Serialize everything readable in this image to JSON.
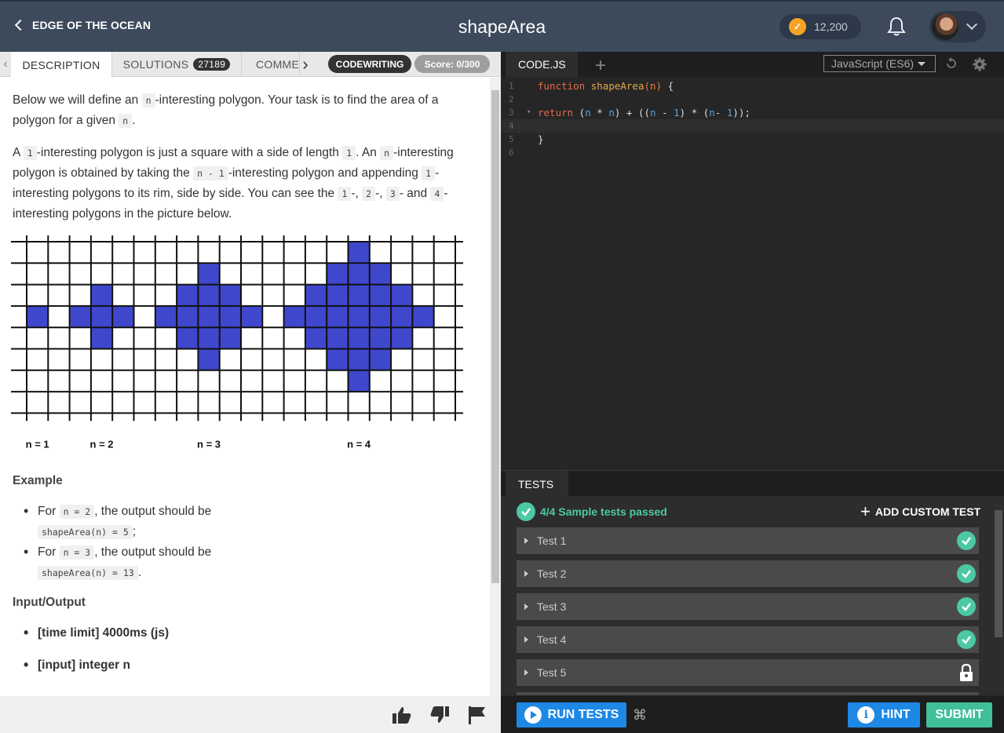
{
  "header": {
    "back_label": "EDGE OF THE OCEAN",
    "title": "shapeArea",
    "coins": "12,200"
  },
  "tabs": [
    {
      "label": "DESCRIPTION"
    },
    {
      "label": "SOLUTIONS",
      "count": "27189"
    },
    {
      "label": "COMMEN"
    }
  ],
  "pills": {
    "mode": "CODEWRITING",
    "score": "Score: 0/300"
  },
  "description": {
    "p1_a": "Below we will define an ",
    "p1_code": "n",
    "p1_b": "-interesting polygon. Your task is to find the area of a polygon for a given ",
    "p1_code2": "n",
    "p1_c": ".",
    "p2_a": "A ",
    "p2_code1": "1",
    "p2_b": "-interesting polygon is just a square with a side of length ",
    "p2_code2": "1",
    "p2_c": ". An ",
    "p2_code3": "n",
    "p2_d": "-interesting polygon is obtained by taking the ",
    "p2_code4": "n - 1",
    "p2_e": "-interesting polygon and appending ",
    "p2_code5": "1",
    "p2_f": "-interesting polygons to its rim, side by side. You can see the ",
    "p2_code6": "1",
    "p2_g": "-, ",
    "p2_code7": "2",
    "p2_h": "-, ",
    "p2_code8": "3",
    "p2_i": "- and ",
    "p2_code9": "4",
    "p2_j": "-interesting polygons in the picture below.",
    "figure_labels": [
      "n = 1",
      "n = 2",
      "n = 3",
      "n = 4"
    ],
    "example_heading": "Example",
    "examples": [
      {
        "pre": "For ",
        "input": "n = 2",
        "mid": ", the output should be",
        "output": "shapeArea(n) = 5",
        "end": ";"
      },
      {
        "pre": "For ",
        "input": "n = 3",
        "mid": ", the output should be",
        "output": "shapeArea(n) = 13",
        "end": "."
      }
    ],
    "io_heading": "Input/Output",
    "io_items": [
      "[time limit] 4000ms (js)",
      "[input] integer n"
    ]
  },
  "editor": {
    "tab": "CODE.JS",
    "language": "JavaScript (ES6)",
    "line_numbers": [
      "1",
      "2",
      "3",
      "4",
      "5",
      "6"
    ]
  },
  "tests": {
    "tab": "TESTS",
    "summary": "4/4 Sample tests passed",
    "add_custom": "ADD CUSTOM TEST",
    "rows": [
      {
        "label": "Test 1",
        "status": "passed"
      },
      {
        "label": "Test 2",
        "status": "passed"
      },
      {
        "label": "Test 3",
        "status": "passed"
      },
      {
        "label": "Test 4",
        "status": "passed"
      },
      {
        "label": "Test 5",
        "status": "locked"
      }
    ]
  },
  "actions": {
    "run": "RUN TESTS",
    "hint": "HINT",
    "submit": "SUBMIT"
  },
  "colors": {
    "topbar": "#3c4a5c",
    "polygon": "#3f48cc",
    "codewriting_pill": "#333333",
    "score_pill": "#9e9e9e",
    "run_button": "#1e88e5",
    "hint_button": "#1e88e5",
    "submit_button": "#3fbf9a",
    "passed": "#4cc9a4"
  }
}
